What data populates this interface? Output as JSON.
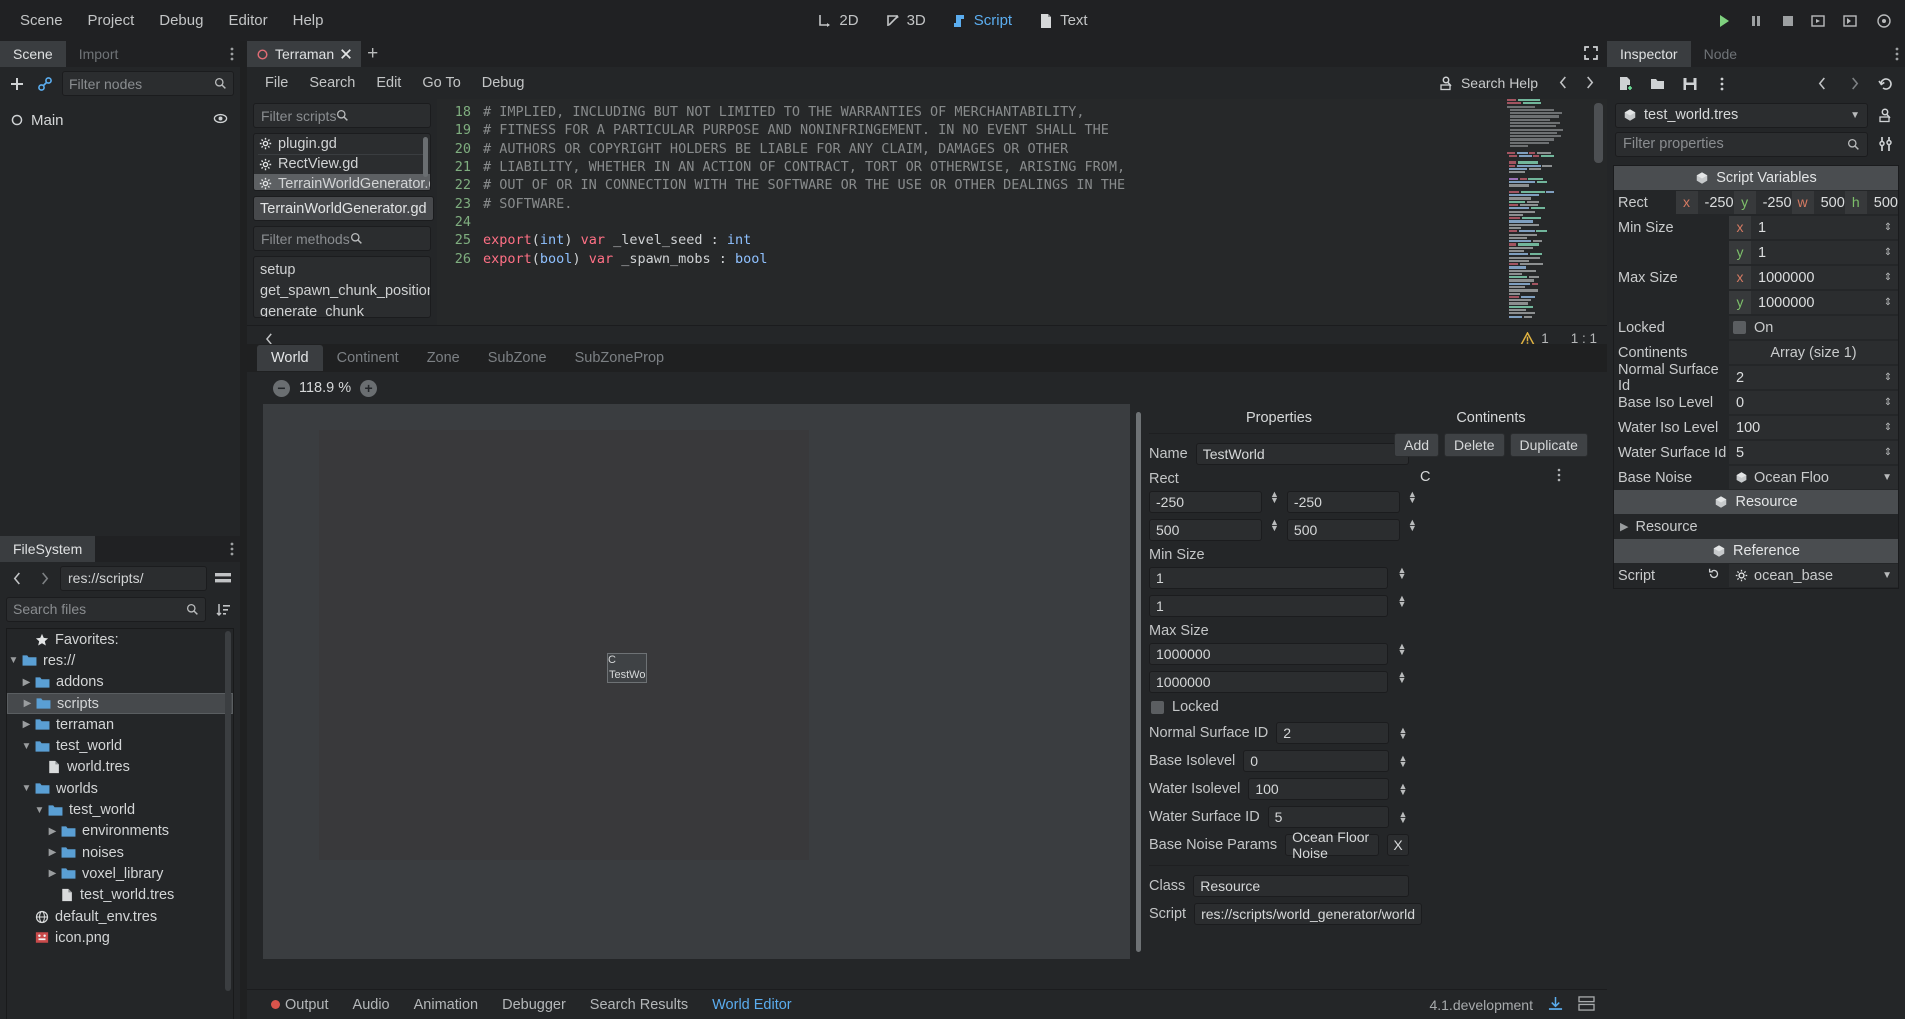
{
  "menu": {
    "items": [
      "Scene",
      "Project",
      "Debug",
      "Editor",
      "Help"
    ]
  },
  "modes": [
    {
      "label": "2D",
      "icon": "2d-icon",
      "active": false
    },
    {
      "label": "3D",
      "icon": "3d-icon",
      "active": false
    },
    {
      "label": "Script",
      "icon": "script-icon",
      "active": true
    },
    {
      "label": "Text",
      "icon": "text-icon",
      "active": false
    }
  ],
  "run_buttons": [
    "play-icon",
    "pause-icon",
    "stop-icon",
    "play-scene-icon",
    "play-custom-icon",
    "movie-icon"
  ],
  "scene_dock": {
    "tabs": [
      {
        "label": "Scene",
        "active": true
      },
      {
        "label": "Import",
        "active": false
      }
    ],
    "filter_placeholder": "Filter nodes",
    "tree": [
      {
        "label": "Main",
        "icon": "node-icon"
      }
    ]
  },
  "filesystem": {
    "tab": "FileSystem",
    "path": "res://scripts/",
    "search_placeholder": "Search files",
    "rows": [
      {
        "label": "Favorites:",
        "icon": "star-icon",
        "indent": 1,
        "arrow": "",
        "type": "header"
      },
      {
        "label": "res://",
        "icon": "folder-icon",
        "indent": 0,
        "arrow": "v",
        "type": "folder"
      },
      {
        "label": "addons",
        "icon": "folder-icon",
        "indent": 1,
        "arrow": ">",
        "type": "folder"
      },
      {
        "label": "scripts",
        "icon": "folder-icon",
        "indent": 1,
        "arrow": ">",
        "type": "folder",
        "selected": true
      },
      {
        "label": "terraman",
        "icon": "folder-icon",
        "indent": 1,
        "arrow": ">",
        "type": "folder"
      },
      {
        "label": "test_world",
        "icon": "folder-icon",
        "indent": 1,
        "arrow": "v",
        "type": "folder"
      },
      {
        "label": "world.tres",
        "icon": "file-icon",
        "indent": 2,
        "arrow": "",
        "type": "file"
      },
      {
        "label": "worlds",
        "icon": "folder-icon",
        "indent": 1,
        "arrow": "v",
        "type": "folder"
      },
      {
        "label": "test_world",
        "icon": "folder-icon",
        "indent": 2,
        "arrow": "v",
        "type": "folder"
      },
      {
        "label": "environments",
        "icon": "folder-icon",
        "indent": 3,
        "arrow": ">",
        "type": "folder"
      },
      {
        "label": "noises",
        "icon": "folder-icon",
        "indent": 3,
        "arrow": ">",
        "type": "folder"
      },
      {
        "label": "voxel_library",
        "icon": "folder-icon",
        "indent": 3,
        "arrow": ">",
        "type": "folder"
      },
      {
        "label": "test_world.tres",
        "icon": "file-icon",
        "indent": 3,
        "arrow": "",
        "type": "file"
      },
      {
        "label": "default_env.tres",
        "icon": "globe-icon",
        "indent": 1,
        "arrow": "",
        "type": "file"
      },
      {
        "label": "icon.png",
        "icon": "image-icon",
        "indent": 1,
        "arrow": "",
        "type": "file"
      }
    ]
  },
  "script_panel": {
    "tab": {
      "label": "Terraman",
      "icon": "script-tab-icon"
    },
    "add_tab_label": "+",
    "menu": [
      "File",
      "Search",
      "Edit",
      "Go To",
      "Debug"
    ],
    "search_help_label": "Search Help",
    "filter_scripts_placeholder": "Filter scripts",
    "script_list": [
      {
        "label": "plugin.gd",
        "selected": false
      },
      {
        "label": "RectView.gd",
        "selected": false
      },
      {
        "label": "TerrainWorldGenerator.gd",
        "selected": true
      }
    ],
    "selected_script": "TerrainWorldGenerator.gd",
    "filter_methods_placeholder": "Filter methods",
    "methods": [
      "setup",
      "get_spawn_chunk_position",
      "generate_chunk"
    ],
    "code": [
      {
        "num": "18",
        "tokens": [
          {
            "t": "# IMPLIED, INCLUDING BUT NOT LIMITED TO THE WARRANTIES OF MERCHANTABILITY,",
            "c": "cm"
          }
        ]
      },
      {
        "num": "19",
        "tokens": [
          {
            "t": "# FITNESS FOR A PARTICULAR PURPOSE AND NONINFRINGEMENT. IN NO EVENT SHALL THE",
            "c": "cm"
          }
        ]
      },
      {
        "num": "20",
        "tokens": [
          {
            "t": "# AUTHORS OR COPYRIGHT HOLDERS BE LIABLE FOR ANY CLAIM, DAMAGES OR OTHER",
            "c": "cm"
          }
        ]
      },
      {
        "num": "21",
        "tokens": [
          {
            "t": "# LIABILITY, WHETHER IN AN ACTION OF CONTRACT, TORT OR OTHERWISE, ARISING FROM,",
            "c": "cm"
          }
        ]
      },
      {
        "num": "22",
        "tokens": [
          {
            "t": "# OUT OF OR IN CONNECTION WITH THE SOFTWARE OR THE USE OR OTHER DEALINGS IN THE",
            "c": "cm"
          }
        ]
      },
      {
        "num": "23",
        "tokens": [
          {
            "t": "# SOFTWARE.",
            "c": "cm"
          }
        ]
      },
      {
        "num": "24",
        "tokens": [
          {
            "t": "",
            "c": "id"
          }
        ]
      },
      {
        "num": "25",
        "tokens": [
          {
            "t": "export",
            "c": "kw"
          },
          {
            "t": "(",
            "c": "id"
          },
          {
            "t": "int",
            "c": "bi"
          },
          {
            "t": ") ",
            "c": "id"
          },
          {
            "t": "var",
            "c": "kw"
          },
          {
            "t": " _level_seed : ",
            "c": "id"
          },
          {
            "t": "int",
            "c": "bi"
          }
        ]
      },
      {
        "num": "26",
        "tokens": [
          {
            "t": "export",
            "c": "kw"
          },
          {
            "t": "(",
            "c": "id"
          },
          {
            "t": "bool",
            "c": "bi"
          },
          {
            "t": ") ",
            "c": "id"
          },
          {
            "t": "var",
            "c": "kw"
          },
          {
            "t": " _spawn_mobs : ",
            "c": "id"
          },
          {
            "t": "bool",
            "c": "bi"
          }
        ]
      }
    ],
    "status": {
      "warnings": "1",
      "line": "1",
      "col": "1"
    }
  },
  "world_editor": {
    "tabs": [
      {
        "label": "World",
        "active": true
      },
      {
        "label": "Continent",
        "active": false
      },
      {
        "label": "Zone",
        "active": false
      },
      {
        "label": "SubZone",
        "active": false
      },
      {
        "label": "SubZoneProp",
        "active": false
      }
    ],
    "zoom": "118.9 %",
    "zoom_out_icon": "minus-circle-icon",
    "zoom_in_icon": "plus-circle-icon",
    "canvas_node": {
      "label_top": "C",
      "label_bottom": "TestWo"
    },
    "properties": {
      "title": "Properties",
      "name_label": "Name",
      "name_value": "TestWorld",
      "rect_label": "Rect",
      "rect": [
        "-250",
        "-250",
        "500",
        "500"
      ],
      "min_size_label": "Min Size",
      "min_size": [
        "1",
        "1"
      ],
      "max_size_label": "Max Size",
      "max_size": [
        "1000000",
        "1000000"
      ],
      "locked_label": "Locked",
      "locked_checked": false,
      "fields": [
        {
          "label": "Normal Surface ID",
          "value": "2"
        },
        {
          "label": "Base Isolevel",
          "value": "0"
        },
        {
          "label": "Water Isolevel",
          "value": "100"
        },
        {
          "label": "Water Surface ID",
          "value": "5"
        }
      ],
      "base_noise_label": "Base Noise Params",
      "base_noise_value": "Ocean Floor Noise",
      "base_noise_clear": "X",
      "class_label": "Class",
      "class_value": "Resource",
      "script_label": "Script",
      "script_value": "res://scripts/world_generator/world"
    },
    "continents": {
      "title": "Continents",
      "buttons": [
        "Add",
        "Delete",
        "Duplicate"
      ],
      "items": [
        "C"
      ]
    }
  },
  "bottom_bar": {
    "items": [
      {
        "label": "Output",
        "active": false,
        "dot": true
      },
      {
        "label": "Audio",
        "active": false
      },
      {
        "label": "Animation",
        "active": false
      },
      {
        "label": "Debugger",
        "active": false
      },
      {
        "label": "Search Results",
        "active": false
      },
      {
        "label": "World Editor",
        "active": true
      }
    ],
    "version": "4.1.development"
  },
  "inspector": {
    "tabs": [
      {
        "label": "Inspector",
        "active": true
      },
      {
        "label": "Node",
        "active": false
      }
    ],
    "toolbar_icons": [
      "new-resource-icon",
      "open-icon",
      "save-icon",
      "more-icon",
      "back-icon",
      "forward-icon",
      "history-icon"
    ],
    "resource_name": "test_world.tres",
    "filter_placeholder": "Filter properties",
    "category": "Script Variables",
    "rect_label": "Rect",
    "rect": [
      {
        "key": "x",
        "value": "-250"
      },
      {
        "key": "y",
        "value": "-250"
      },
      {
        "key": "w",
        "value": "500"
      },
      {
        "key": "h",
        "value": "500"
      }
    ],
    "min_size_label": "Min Size",
    "min_size": [
      {
        "key": "x",
        "value": "1"
      },
      {
        "key": "y",
        "value": "1"
      }
    ],
    "max_size_label": "Max Size",
    "max_size": [
      {
        "key": "x",
        "value": "1000000"
      },
      {
        "key": "y",
        "value": "1000000"
      }
    ],
    "locked_label": "Locked",
    "locked_value": "On",
    "continents_label": "Continents",
    "continents_value": "Array (size 1)",
    "props": [
      {
        "label": "Normal Surface Id",
        "value": "2"
      },
      {
        "label": "Base Iso Level",
        "value": "0"
      },
      {
        "label": "Water Iso Level",
        "value": "100"
      },
      {
        "label": "Water Surface Id",
        "value": "5"
      }
    ],
    "base_noise_label": "Base Noise",
    "base_noise_value": "Ocean Floo",
    "resource_header": "Resource",
    "resource_sub": "Resource",
    "reference_header": "Reference",
    "script_label": "Script",
    "script_value": "ocean_base"
  },
  "colors": {
    "accent": "#5badef",
    "panel": "#242628",
    "field": "#2b2d2f",
    "folder": "#5a9fd4",
    "warning": "#e0b341",
    "error": "#d8544c",
    "keyword": "#ff7085",
    "builtin": "#8fc1ff",
    "comment": "#888b8c",
    "linenum": "#7fae7f"
  }
}
